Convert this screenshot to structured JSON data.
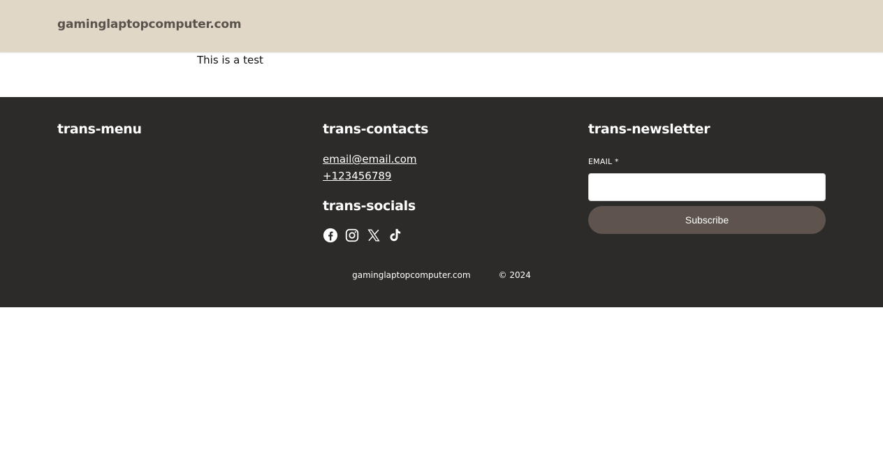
{
  "header": {
    "site_title": "gaminglaptopcomputer.com"
  },
  "main": {
    "text": "This is a test"
  },
  "footer": {
    "menu": {
      "heading": "trans-menu"
    },
    "contacts": {
      "heading": "trans-contacts",
      "email": "email@email.com",
      "phone": "+123456789"
    },
    "socials": {
      "heading": "trans-socials",
      "icons": [
        "facebook-icon",
        "instagram-icon",
        "x-icon",
        "tiktok-icon"
      ]
    },
    "newsletter": {
      "heading": "trans-newsletter",
      "email_label": "EMAIL *",
      "email_value": "",
      "subscribe_label": "Subscribe"
    },
    "bottom": {
      "site_link": "gaminglaptopcomputer.com",
      "copyright": "© 2024"
    }
  },
  "colors": {
    "header_bg": "#e0d7c6",
    "footer_bg": "#2d2b29",
    "button_bg": "#5e544d",
    "title_text": "#5a534d"
  }
}
